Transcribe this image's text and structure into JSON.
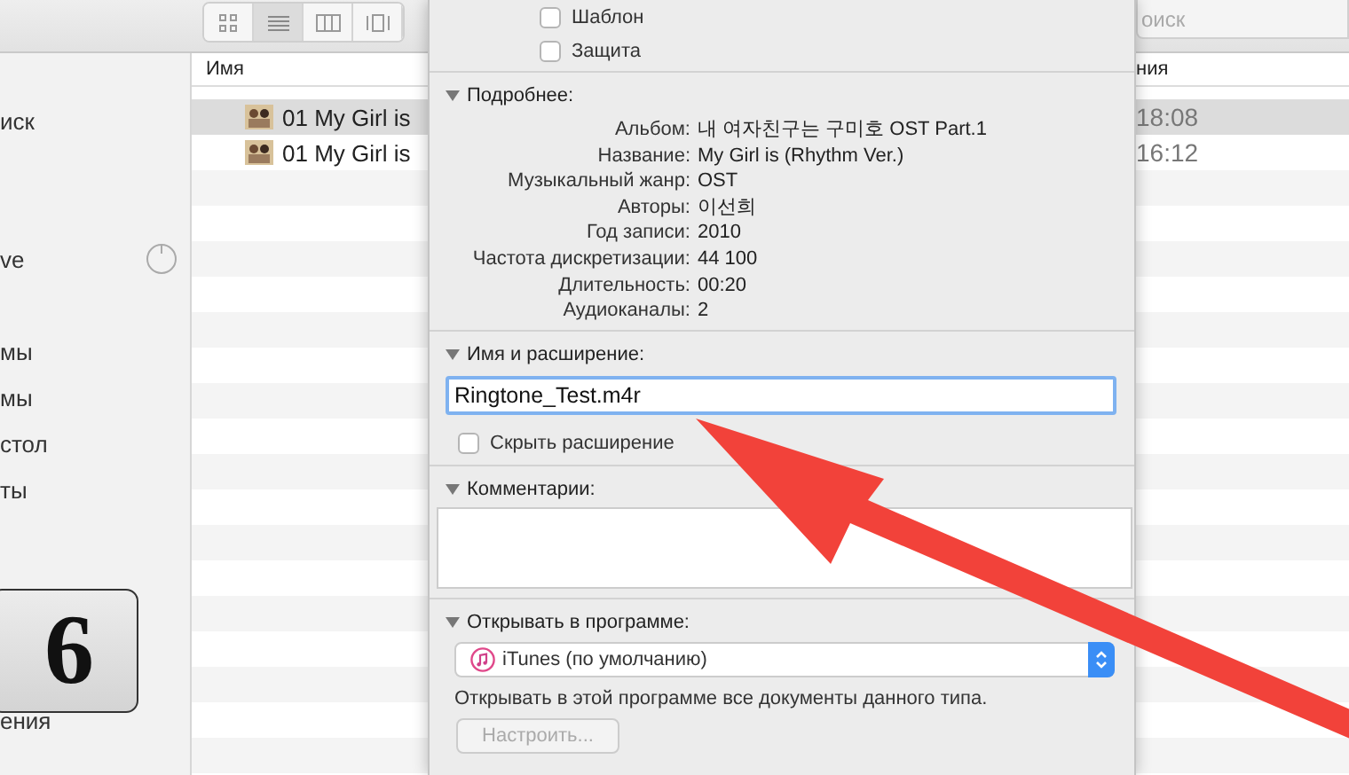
{
  "toolbar": {
    "view_buttons": [
      {
        "kind": "icons",
        "selected": false
      },
      {
        "kind": "list",
        "selected": true
      },
      {
        "kind": "columns",
        "selected": false
      },
      {
        "kind": "gallery",
        "selected": false
      }
    ],
    "search": {
      "placeholder": "оиск"
    }
  },
  "sidebar": {
    "sections": [
      {
        "items": [
          {
            "label": "иск",
            "kind": "place"
          }
        ]
      },
      {
        "items": [
          {
            "label": "ve",
            "kind": "drive"
          }
        ]
      },
      {
        "items": [
          {
            "label": "мы",
            "kind": "place"
          },
          {
            "label": "мы",
            "kind": "place"
          },
          {
            "label": "стол",
            "kind": "place"
          },
          {
            "label": "ты",
            "kind": "place"
          }
        ]
      },
      {
        "items": [
          {
            "label": "ения",
            "kind": "place"
          }
        ]
      }
    ]
  },
  "file_list": {
    "columns": [
      "Имя",
      "ния"
    ],
    "rows": [
      {
        "name": "01 My Girl is",
        "time": "18:08",
        "selected": true
      },
      {
        "name": "01 My Girl is",
        "time": "16:12",
        "selected": false
      }
    ]
  },
  "info": {
    "checkboxes": [
      {
        "label": "Шаблон",
        "checked": false
      },
      {
        "label": "Защита",
        "checked": false
      }
    ],
    "details": {
      "title": "Подробнее:",
      "expanded": true,
      "rows": [
        {
          "key": "Альбом:",
          "value": "내 여자친구는 구미호 OST Part.1"
        },
        {
          "key": "Название:",
          "value": "My Girl is (Rhythm Ver.)"
        },
        {
          "key": "Музыкальный жанр:",
          "value": "OST"
        },
        {
          "key": "Авторы:",
          "value": "이선희"
        },
        {
          "key": "Год записи:",
          "value": "2010"
        },
        {
          "key": "Частота дискретизации:",
          "value": "44 100"
        },
        {
          "key": "Длительность:",
          "value": "00:20"
        },
        {
          "key": "Аудиоканалы:",
          "value": "2"
        }
      ]
    },
    "name_section": {
      "title": "Имя и расширение:",
      "expanded": true,
      "value": "Ringtone_Test.m4r",
      "hide_extension": {
        "label": "Скрыть расширение",
        "checked": false
      }
    },
    "comments": {
      "title": "Комментарии:",
      "expanded": true
    },
    "open_with": {
      "title": "Открывать в программе:",
      "expanded": true,
      "app": "iTunes (по умолчанию)",
      "note": "Открывать в этой программе все документы данного типа.",
      "button": {
        "label": "Настроить...",
        "disabled": true
      }
    }
  },
  "step_badge": "6"
}
